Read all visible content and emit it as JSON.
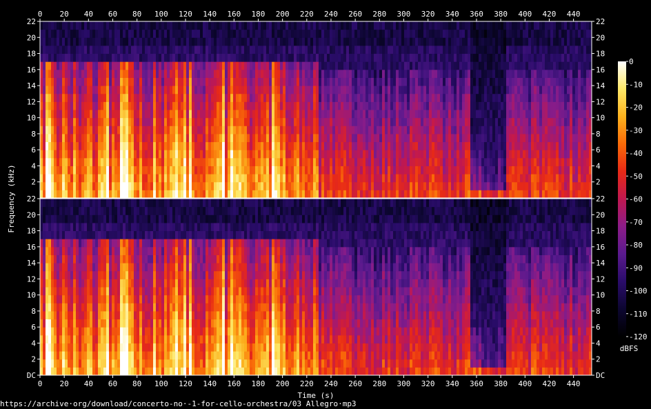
{
  "source_url": "https://archive·org/download/concerto-no·-1-for-cello-orchestra/03 Allegro·mp3",
  "chart_data": {
    "type": "heatmap",
    "title": "",
    "xlabel": "Time (s)",
    "ylabel": "Frequency (kHz)",
    "xlim": [
      0,
      455
    ],
    "ylim": [
      0,
      22
    ],
    "x_ticks": [
      "0",
      "20",
      "40",
      "60",
      "80",
      "100",
      "120",
      "140",
      "160",
      "180",
      "200",
      "220",
      "240",
      "260",
      "280",
      "300",
      "320",
      "340",
      "360",
      "380",
      "400",
      "420",
      "440"
    ],
    "y_ticks_channel": [
      "DC",
      "2",
      "4",
      "6",
      "8",
      "10",
      "12",
      "14",
      "16",
      "18",
      "20",
      "22"
    ],
    "channels": 2,
    "colorbar": {
      "label": "dBFS",
      "range": [
        -120,
        0
      ],
      "ticks": [
        "0",
        "-10",
        "-20",
        "-30",
        "-40",
        "-50",
        "-60",
        "-70",
        "-80",
        "-90",
        "-100",
        "-110",
        "-120"
      ],
      "stops": [
        "#000000",
        "#0c0630",
        "#2a0c6a",
        "#5a1a8e",
        "#8c1c88",
        "#c01850",
        "#e82a16",
        "#f96a08",
        "#fcb21e",
        "#fde868",
        "#ffffff"
      ]
    },
    "sections": [
      {
        "range_s": [
          0,
          230
        ],
        "level": "loud",
        "energy_limit_khz": 17
      },
      {
        "range_s": [
          230,
          355
        ],
        "level": "moderate",
        "energy_limit_khz": 16
      },
      {
        "range_s": [
          355,
          385
        ],
        "level": "quiet",
        "energy_limit_khz": 6
      },
      {
        "range_s": [
          385,
          455
        ],
        "level": "moderate",
        "energy_limit_khz": 16
      }
    ]
  }
}
